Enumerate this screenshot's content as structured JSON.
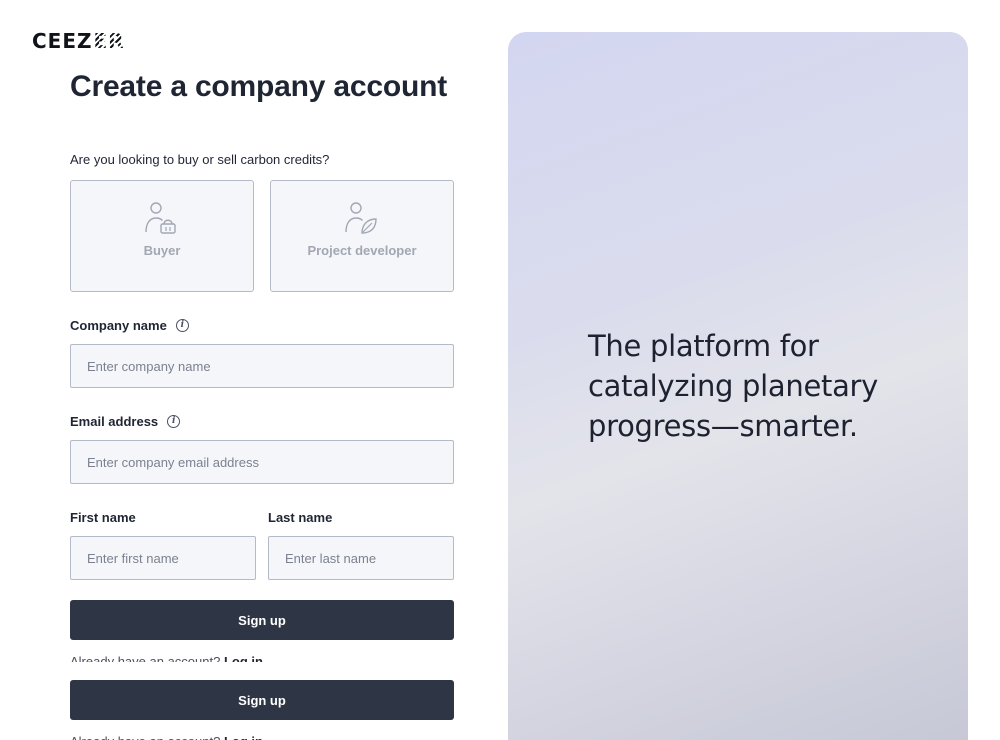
{
  "brand": {
    "logo_text": "CEEZ",
    "logo_stripe": "ER"
  },
  "page_title": "Create a company account",
  "question": "Are you looking to buy or sell carbon credits?",
  "choices": [
    {
      "label": "Buyer",
      "icon": "person-basket-icon"
    },
    {
      "label": "Project developer",
      "icon": "person-leaf-icon"
    }
  ],
  "company": {
    "label": "Company name",
    "placeholder": "Enter company name"
  },
  "email": {
    "label": "Email address",
    "placeholder": "Enter company email address"
  },
  "first_name": {
    "label": "First name",
    "placeholder": "Enter first name"
  },
  "last_name": {
    "label": "Last name",
    "placeholder": "Enter last name"
  },
  "signup_label": "Sign up",
  "login": {
    "prompt": "Already have an account?",
    "link": "Log in"
  },
  "hero": {
    "text": "The platform for catalyzing planetary progress—smarter."
  },
  "colors": {
    "button": "#2e3545",
    "hero_start": "#d3d6f0",
    "hero_end": "#c7c8d6"
  }
}
